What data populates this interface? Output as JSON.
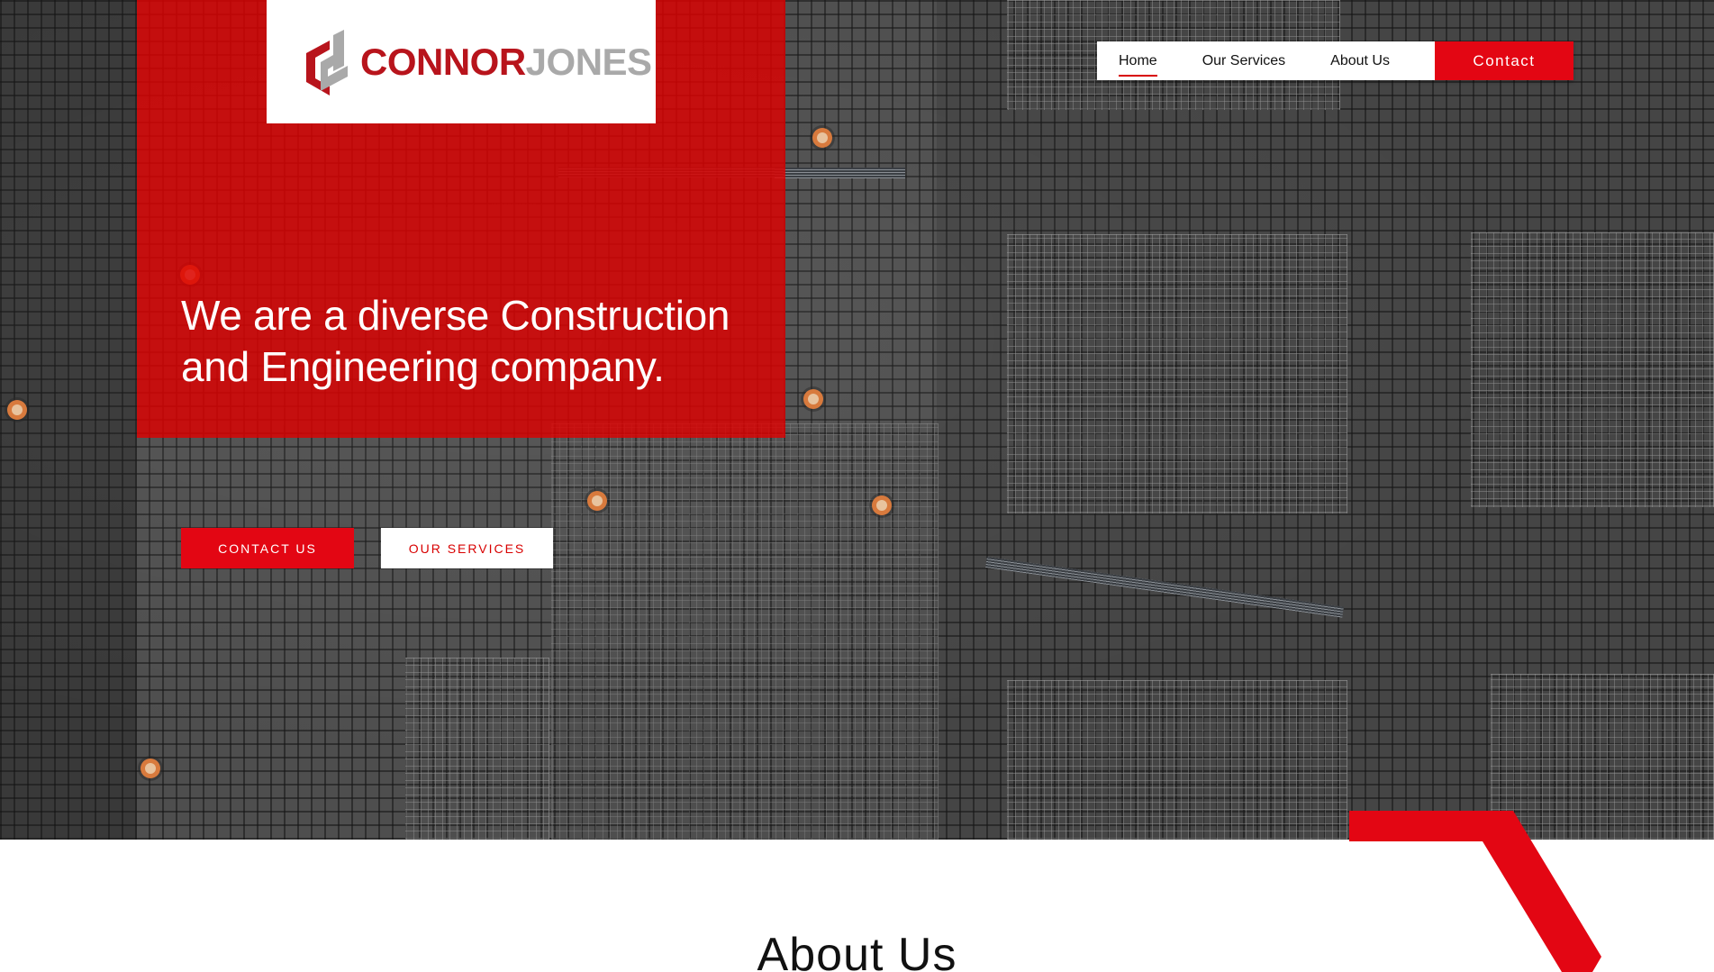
{
  "brand": {
    "logo_primary": "CONNOR",
    "logo_secondary": "JONES",
    "primary_color": "#e30613",
    "logo_red": "#b8141c",
    "logo_grey": "#a9a9a9"
  },
  "nav": {
    "items": [
      {
        "label": "Home",
        "active": true
      },
      {
        "label": "Our Services",
        "active": false
      },
      {
        "label": "About Us",
        "active": false
      }
    ],
    "contact_label": "Contact"
  },
  "hero": {
    "headline_line1": "We are a diverse Construction",
    "headline_line2": "and Engineering company.",
    "cta_primary": "CONTACT US",
    "cta_secondary": "OUR SERVICES"
  },
  "about": {
    "title": "About Us"
  },
  "icons": [
    "logo-mark-icon",
    "red-chevron-decoration"
  ]
}
